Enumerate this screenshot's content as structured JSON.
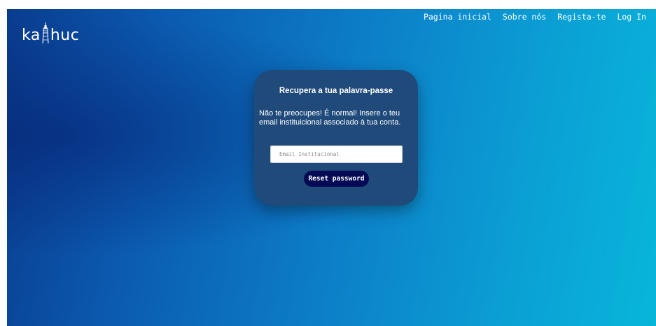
{
  "brand": {
    "prefix": "ka",
    "suffix": "huc",
    "icon": "tower-icon"
  },
  "nav": {
    "items": [
      {
        "label": "Pagina inicial"
      },
      {
        "label": "Sobre nós"
      },
      {
        "label": "Regista-te"
      },
      {
        "label": "Log In"
      }
    ]
  },
  "card": {
    "title": "Recupera a tua palavra-passe",
    "description": "Não te preocupes! É normal! Insere o teu email instituicional associado à tua conta.",
    "email_placeholder": "Email Institucional",
    "email_value": "",
    "button_label": "Reset password"
  },
  "colors": {
    "card_bg": "#1f4a7a",
    "button_bg": "#050a55",
    "gradient_start": "#0a3c8e",
    "gradient_end": "#08b6da"
  }
}
